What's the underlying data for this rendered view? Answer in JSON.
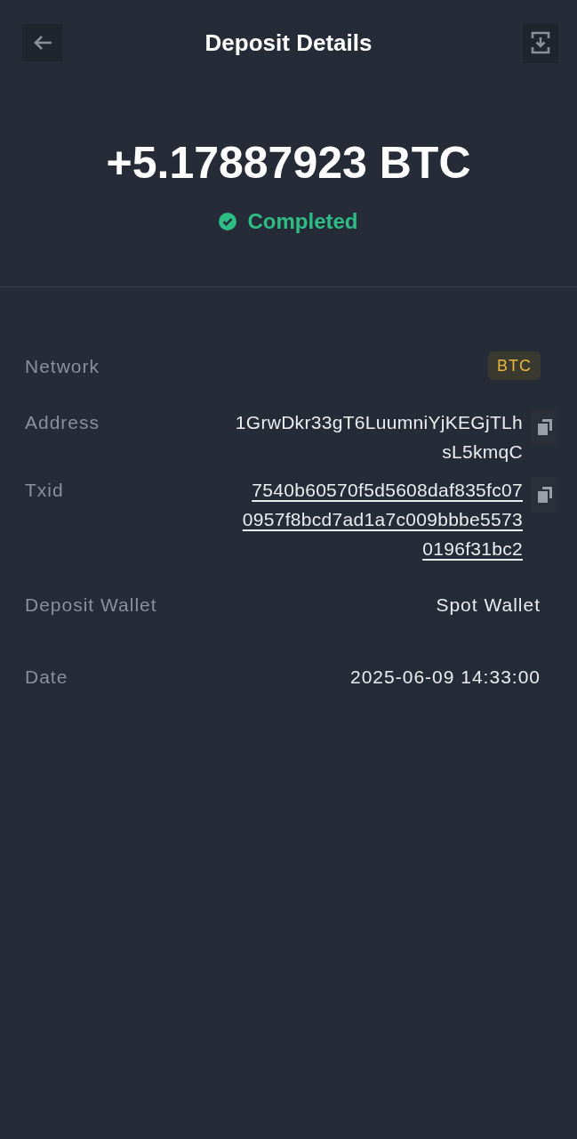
{
  "header": {
    "title": "Deposit Details"
  },
  "summary": {
    "amount": "+5.17887923 BTC",
    "status": {
      "kind": "completed",
      "label": "Completed"
    }
  },
  "details": [
    {
      "kind": "badge",
      "label": "Network",
      "value": "BTC"
    },
    {
      "kind": "copy",
      "label": "Address",
      "link": false,
      "lines": [
        "1GrwDkr33gT6LuumniYjKEGjTLh",
        "sL5kmqC"
      ]
    },
    {
      "kind": "copy",
      "label": "Txid",
      "link": true,
      "lines": [
        "7540b60570f5d5608daf835fc07",
        "0957f8bcd7ad1a7c009bbbe5573",
        "0196f31bc2"
      ]
    },
    {
      "kind": "text",
      "label": "Deposit Wallet",
      "value": "Spot Wallet"
    },
    {
      "kind": "text",
      "label": "Date",
      "value": "2025-06-09 14:33:00"
    }
  ]
}
